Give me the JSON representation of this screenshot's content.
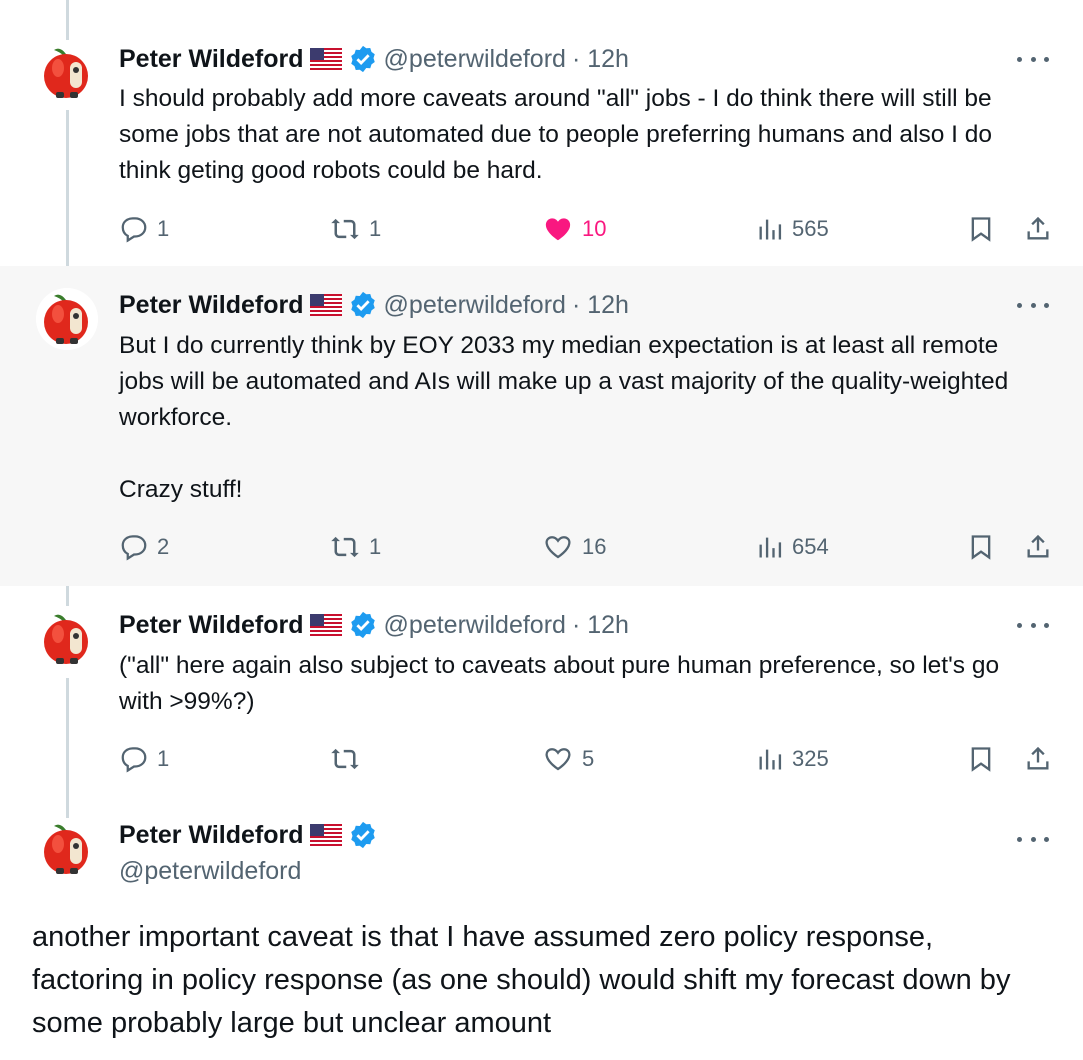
{
  "colors": {
    "text": "#0f1419",
    "secondary": "#536471",
    "like": "#f91880",
    "verified": "#1d9bf0",
    "highlight_bg": "#f7f7f7"
  },
  "author": {
    "name": "Peter Wildeford",
    "handle": "@peterwildeford",
    "flag_icon": "us-flag-icon",
    "badge_icon": "verified-badge-icon"
  },
  "tweets": [
    {
      "time": "· 12h",
      "text": "I should probably add more caveats around \"all\" jobs - I do think there will still be some jobs that are not automated due to people preferring humans and also I do think geting good robots could be hard.",
      "replies": "1",
      "reposts": "1",
      "likes": "10",
      "views": "565",
      "liked": true
    },
    {
      "time": "· 12h",
      "text": "But I do currently think by EOY 2033 my median expectation is at least all remote jobs will be automated and AIs will make up a vast majority of the quality-weighted workforce.\n\nCrazy stuff!",
      "replies": "2",
      "reposts": "1",
      "likes": "16",
      "views": "654",
      "liked": false
    },
    {
      "time": "· 12h",
      "text": "(\"all\" here again also subject to caveats about pure human preference, so let's go with >99%?)",
      "replies": "1",
      "reposts": "",
      "likes": "5",
      "views": "325",
      "liked": false
    }
  ],
  "main_tweet": {
    "text": "another important caveat is that I have assumed zero policy response, factoring in policy response (as one should) would shift my forecast down by some probably large but unclear amount"
  }
}
